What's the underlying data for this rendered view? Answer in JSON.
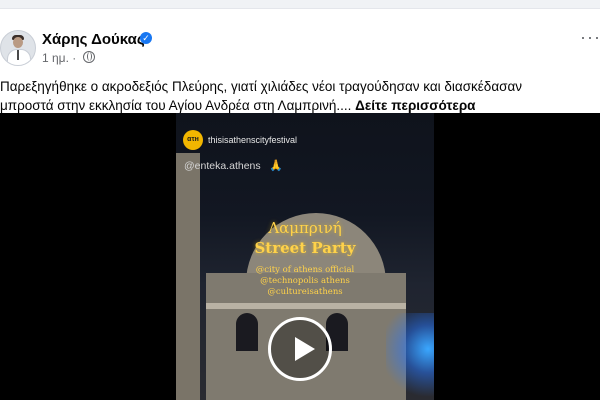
{
  "post": {
    "author": "Χάρης Δούκας",
    "time": "1 ημ.",
    "dot": "·",
    "text_line1": "Παρεξηγήθηκε ο ακροδεξιός Πλεύρης, γιατί χιλιάδες νέοι τραγούδησαν και διασκέδασαν",
    "text_line2": "μπροστά στην εκκλησία του Αγίου Ανδρέα στη Λαμπρινή....",
    "see_more": "Δείτε περισσότερα",
    "more_label": "···",
    "verified_mark": "✓"
  },
  "video": {
    "badge": "ατн",
    "account": "thisisathenscityfestival",
    "mention": "@enteka.athens",
    "title_line1": "Λαμπρινή",
    "title_line2": "Street Party",
    "tags": [
      "@city of athens official",
      "@technopolis athens",
      "@cultureisathens"
    ],
    "praying_icon": "🙏"
  },
  "colors": {
    "accent": "#1877f2",
    "overlay_text": "#ffd24a"
  }
}
